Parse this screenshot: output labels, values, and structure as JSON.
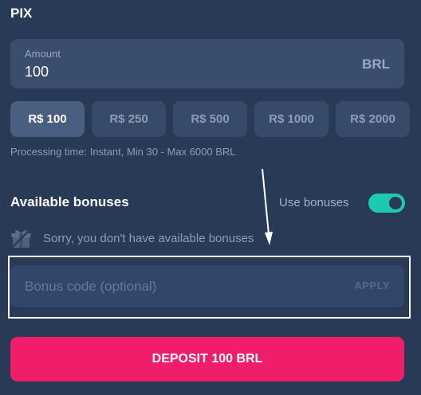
{
  "section": {
    "title": "PIX"
  },
  "amount": {
    "label": "Amount",
    "value": "100",
    "currency": "BRL"
  },
  "quick_amounts": [
    {
      "label": "R$ 100",
      "active": true
    },
    {
      "label": "R$ 250",
      "active": false
    },
    {
      "label": "R$ 500",
      "active": false
    },
    {
      "label": "R$ 1000",
      "active": false
    },
    {
      "label": "R$ 2000",
      "active": false
    }
  ],
  "processing_text": "Processing time: Instant, Min 30 - Max 6000 BRL",
  "bonuses": {
    "title": "Available bonuses",
    "use_label": "Use bonuses",
    "use_enabled": true,
    "empty_icon": "gift-icon",
    "empty_text": "Sorry, you don't have available bonuses"
  },
  "bonus_code": {
    "placeholder": "Bonus code (optional)",
    "value": "",
    "apply_label": "APPLY"
  },
  "deposit_button": {
    "label": "DEPOSIT 100 BRL"
  },
  "colors": {
    "background": "#283a55",
    "field": "#3a4d6d",
    "toggle_on": "#1ec9b2",
    "primary": "#f01d6a",
    "highlight": "#ffffff"
  }
}
